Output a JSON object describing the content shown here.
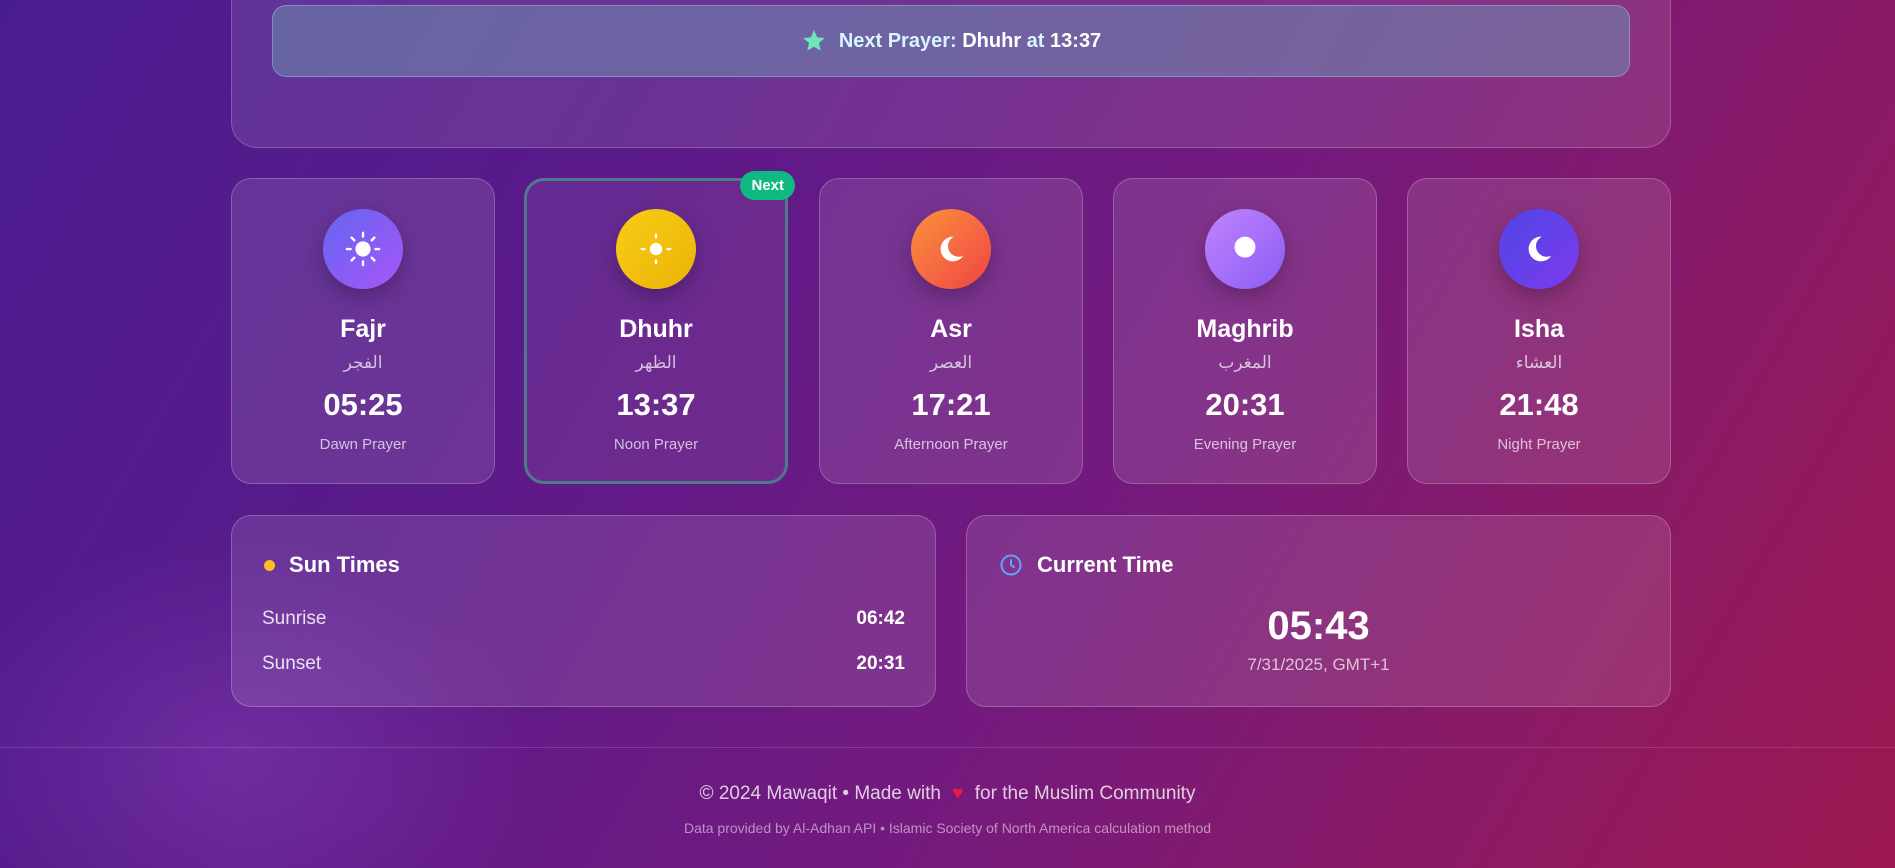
{
  "next_prayer": {
    "label": "Next Prayer:",
    "name": "Dhuhr",
    "at_word": "at",
    "time": "13:37"
  },
  "prayers": [
    {
      "name": "Fajr",
      "arabic": "الفجر",
      "time": "05:25",
      "description": "Dawn Prayer",
      "icon": "sun-icon",
      "colors": [
        "#6366f1",
        "#a855f7"
      ]
    },
    {
      "name": "Dhuhr",
      "arabic": "الظهر",
      "time": "13:37",
      "description": "Noon Prayer",
      "icon": "sun-icon",
      "colors": [
        "#facc15",
        "#eab308"
      ],
      "badge": "Next"
    },
    {
      "name": "Asr",
      "arabic": "العصر",
      "time": "17:21",
      "description": "Afternoon Prayer",
      "icon": "crescent-icon",
      "colors": [
        "#fb923c",
        "#ef4444"
      ]
    },
    {
      "name": "Maghrib",
      "arabic": "المغرب",
      "time": "20:31",
      "description": "Evening Prayer",
      "icon": "moon-dot-icon",
      "colors": [
        "#c084fc",
        "#8b5cf6"
      ]
    },
    {
      "name": "Isha",
      "arabic": "العشاء",
      "time": "21:48",
      "description": "Night Prayer",
      "icon": "crescent-icon",
      "colors": [
        "#4f46e5",
        "#7c3aed"
      ]
    }
  ],
  "sun_times": {
    "title": "Sun Times",
    "sunrise_label": "Sunrise",
    "sunrise": "06:42",
    "sunset_label": "Sunset",
    "sunset": "20:31"
  },
  "current_time": {
    "title": "Current Time",
    "time": "05:43",
    "date": "7/31/2025, GMT+1"
  },
  "footer": {
    "copyright_prefix": "© 2024 Mawaqit • Made with",
    "copyright_suffix": "for the Muslim Community",
    "credits": "Data provided by Al-Adhan API • Islamic Society of North America calculation method"
  },
  "colors": {
    "accent_green": "#10b981",
    "star": "#6ee7b7",
    "sun_dot": "#fbbf24",
    "clock": "#60a5fa",
    "heart": "#e11d48"
  }
}
